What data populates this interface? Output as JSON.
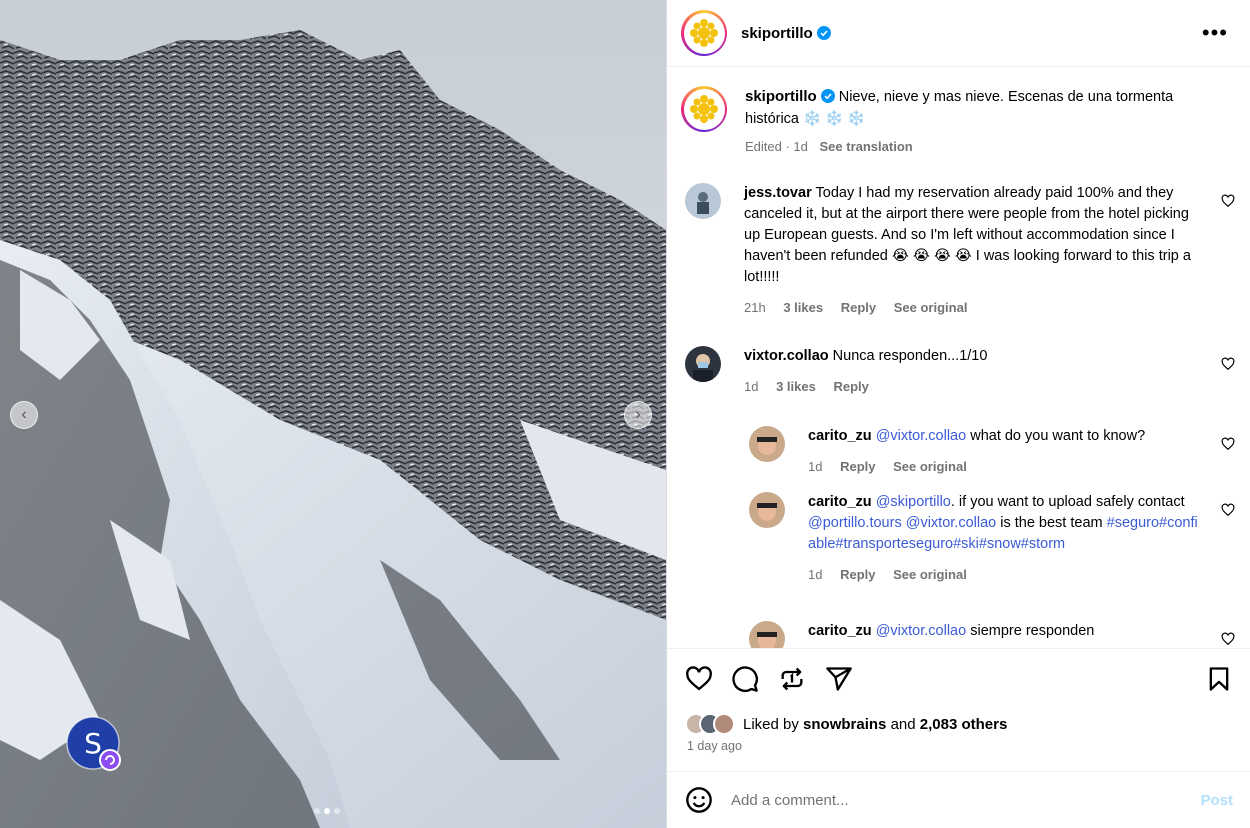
{
  "media": {
    "icons": {
      "prev": "chevron-left-icon",
      "next": "chevron-right-icon"
    },
    "carousel_total": 3,
    "carousel_active": 2
  },
  "header": {
    "username": "skiportillo",
    "more_icon": "more-horizontal-icon"
  },
  "caption": {
    "username": "skiportillo",
    "text": "Nieve, nieve y mas nieve. Escenas de una tormenta histórica ❄️ ❄️ ❄️",
    "edited": "Edited · 1d",
    "see_translation": "See translation"
  },
  "comments": [
    {
      "user": "jess.tovar",
      "text": "Today I had my reservation already paid 100% and they canceled it, but at the airport there were people from the hotel picking up European guests. And so I'm left without accommodation since I haven't been refunded 😭 😭 😭 😭  I was looking forward to this trip a lot!!!!!",
      "time": "21h",
      "likes": "3 likes",
      "reply": "Reply",
      "see_original": "See original"
    },
    {
      "user": "vixtor.collao",
      "text": "Nunca responden...1/10",
      "time": "1d",
      "likes": "3 likes",
      "reply": "Reply"
    }
  ],
  "replies": [
    {
      "user": "carito_zu",
      "mention": "@vixtor.collao",
      "text": " what do you want to know?",
      "time": "1d",
      "reply": "Reply",
      "see_original": "See original"
    },
    {
      "user": "carito_zu",
      "mention": "@skiportillo",
      "text1": ". if you want to upload safely contact ",
      "mention2": "@portillo.tours",
      "mention3": "@vixtor.collao",
      "text2": " is the best team ",
      "hashtags": "#seguro#confiable#transporteseguro#ski#snow#storm",
      "time": "1d",
      "reply": "Reply",
      "see_original": "See original"
    },
    {
      "user": "carito_zu",
      "mention": "@vixtor.collao",
      "text": " siempre responden"
    }
  ],
  "actions": {
    "icons": [
      "heart-icon",
      "comment-icon",
      "repost-icon",
      "share-icon",
      "bookmark-icon"
    ]
  },
  "likes": {
    "prefix": "Liked by ",
    "user": "snowbrains",
    "mid": " and ",
    "others": "2,083 others",
    "ago": "1 day ago"
  },
  "add_comment": {
    "placeholder": "Add a comment...",
    "post": "Post",
    "emoji_icon": "smile-icon"
  },
  "colors": {
    "link": "#3b5bd6",
    "verified": "#0095f6",
    "post_disabled": "#b2dffc",
    "meta": "#737373"
  }
}
